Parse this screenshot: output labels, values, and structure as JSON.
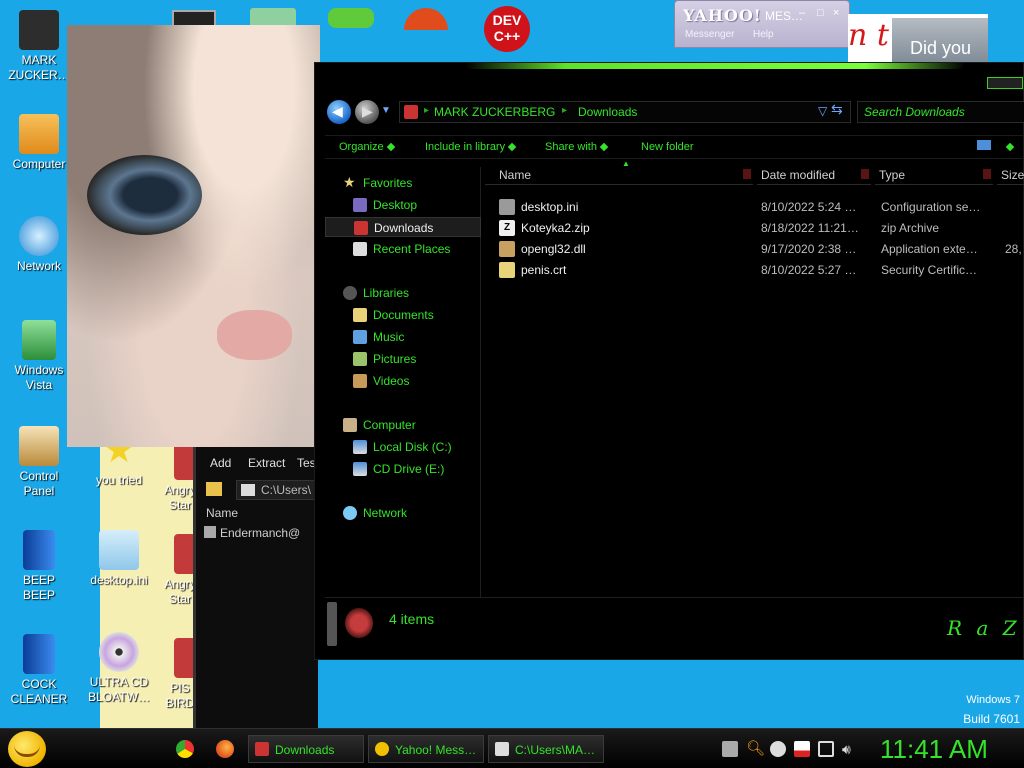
{
  "desktop": {
    "icons": [
      {
        "label": "MARK\nZUCKER…",
        "icon": "user-folder-icon",
        "color": "#2d2d2d"
      },
      {
        "label": "Computer",
        "icon": "computer-icon",
        "color": "#f3a627"
      },
      {
        "label": "Network",
        "icon": "network-icon",
        "color": "#7cc9f3"
      },
      {
        "label": "Windows\nVista",
        "icon": "recycle-bin-icon",
        "color": "#3fae4f"
      },
      {
        "label": "Control\nPanel",
        "icon": "control-panel-icon",
        "color": "#b98a3a"
      },
      {
        "label": "BEEP\nBEEP",
        "icon": "blue-book-icon",
        "color": "#1b5fcf"
      },
      {
        "label": "COCK\nCLEANER",
        "icon": "blue-book-icon",
        "color": "#1b5fcf"
      },
      {
        "label": "you tried",
        "icon": "star-icon",
        "color": "#f3d227"
      },
      {
        "label": "desktop.ini",
        "icon": "settings-file-icon",
        "color": "#8fc7ea"
      },
      {
        "label": "ULTRA CD\nBLOATW…",
        "icon": "cd-icon",
        "color": "#d8d8d8"
      },
      {
        "label": "Angry\nStar",
        "icon": "game-icon",
        "color": "#c23a3a"
      },
      {
        "label": "Angry\nStar",
        "icon": "game-icon",
        "color": "#c23a3a"
      },
      {
        "label": "PIS\nBIRD",
        "icon": "game-icon",
        "color": "#c23a3a"
      }
    ]
  },
  "yahoo": {
    "brand": "YAHOO!",
    "title": "MES…",
    "menu1": "Messenger",
    "menu2": "Help",
    "banner_text": "n t",
    "did_you": "Did you"
  },
  "zip_window": {
    "menu": [
      "Add",
      "Extract",
      "Tes"
    ],
    "path": "C:\\Users\\",
    "column": "Name",
    "row": "Endermanch@"
  },
  "explorer": {
    "breadcrumb": [
      "MARK ZUCKERBERG",
      "Downloads"
    ],
    "search_placeholder": "Search Downloads",
    "toolbar": [
      "Organize",
      "Include in library",
      "Share with",
      "New folder"
    ],
    "nav": {
      "favorites": "Favorites",
      "favorites_items": [
        "Desktop",
        "Downloads",
        "Recent Places"
      ],
      "libraries": "Libraries",
      "libraries_items": [
        "Documents",
        "Music",
        "Pictures",
        "Videos"
      ],
      "computer": "Computer",
      "computer_items": [
        "Local Disk (C:)",
        "CD Drive (E:)"
      ],
      "network": "Network"
    },
    "columns": [
      "Name",
      "Date modified",
      "Type",
      "Size"
    ],
    "files": [
      {
        "name": "desktop.ini",
        "date": "8/10/2022 5:24 …",
        "type": "Configuration se…",
        "size": "",
        "icon": "settings-file-icon",
        "color": "#9a9a9a"
      },
      {
        "name": "Koteyka2.zip",
        "date": "8/18/2022 11:21…",
        "type": "zip Archive",
        "size": "",
        "icon": "zip-file-icon",
        "color": "#f0f0f0"
      },
      {
        "name": "opengl32.dll",
        "date": "9/17/2020 2:38 …",
        "type": "Application exte…",
        "size": "28,",
        "icon": "dll-file-icon",
        "color": "#c8a060"
      },
      {
        "name": "penis.crt",
        "date": "8/10/2022 5:27 …",
        "type": "Security Certific…",
        "size": "",
        "icon": "certificate-icon",
        "color": "#e8d27a"
      }
    ],
    "item_count": "4 items",
    "logo": "R a Z"
  },
  "watermark": {
    "os": "Windows 7",
    "build": "Build 7601"
  },
  "taskbar": {
    "tasks": [
      {
        "label": "Downloads",
        "icon": "folder-icon",
        "color": "#c33"
      },
      {
        "label": "Yahoo! Mess…",
        "icon": "yahoo-smiley-icon",
        "color": "#f0c000"
      },
      {
        "label": "C:\\Users\\MA…",
        "icon": "zip-app-icon",
        "color": "#ddd"
      }
    ],
    "clock": "11:41 AM"
  }
}
